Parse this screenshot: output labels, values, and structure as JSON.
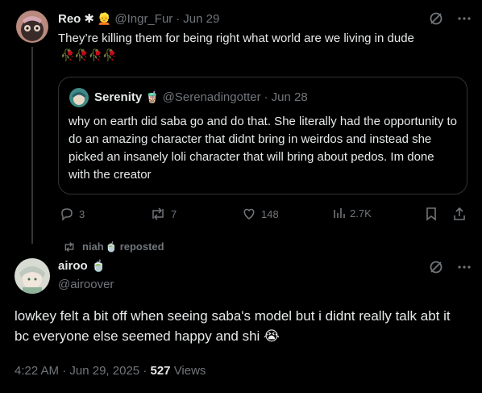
{
  "tweet1": {
    "name": "Reo",
    "badge": "✱",
    "handle": "@Ingr_Fur",
    "dot": "·",
    "date": "Jun 29",
    "text": "They’re killing them for being right what world are we living in dude",
    "emoji_row": "🥀🥀🥀🥀",
    "quote": {
      "name": "Serenity",
      "handle": "@Serenadingotter",
      "dot": "·",
      "date": "Jun 28",
      "text": "why on earth did saba go and do that. She literally had the opportunity to do an amazing character that didnt bring in weirdos and instead she picked an insanely loli character that will bring about pedos. Im done with the creator"
    },
    "actions": {
      "replies": "3",
      "reposts": "7",
      "likes": "148",
      "views": "2.7K"
    }
  },
  "repost_banner": {
    "user": "niah",
    "label": "reposted"
  },
  "tweet2": {
    "name": "airoo",
    "handle": "@airoover",
    "text": "lowkey felt a bit off when seeing saba's model but i didnt really talk abt it bc everyone else seemed happy and shi",
    "emoji": "😭",
    "time": "4:22 AM",
    "dot": "·",
    "date": "Jun 29, 2025",
    "dot2": "·",
    "views_count": "527",
    "views_label": "Views"
  },
  "colors": {
    "background": "#000000",
    "text": "#e7e9ea",
    "muted": "#71767b",
    "border": "#2f3336",
    "rose": "#d4386e"
  }
}
